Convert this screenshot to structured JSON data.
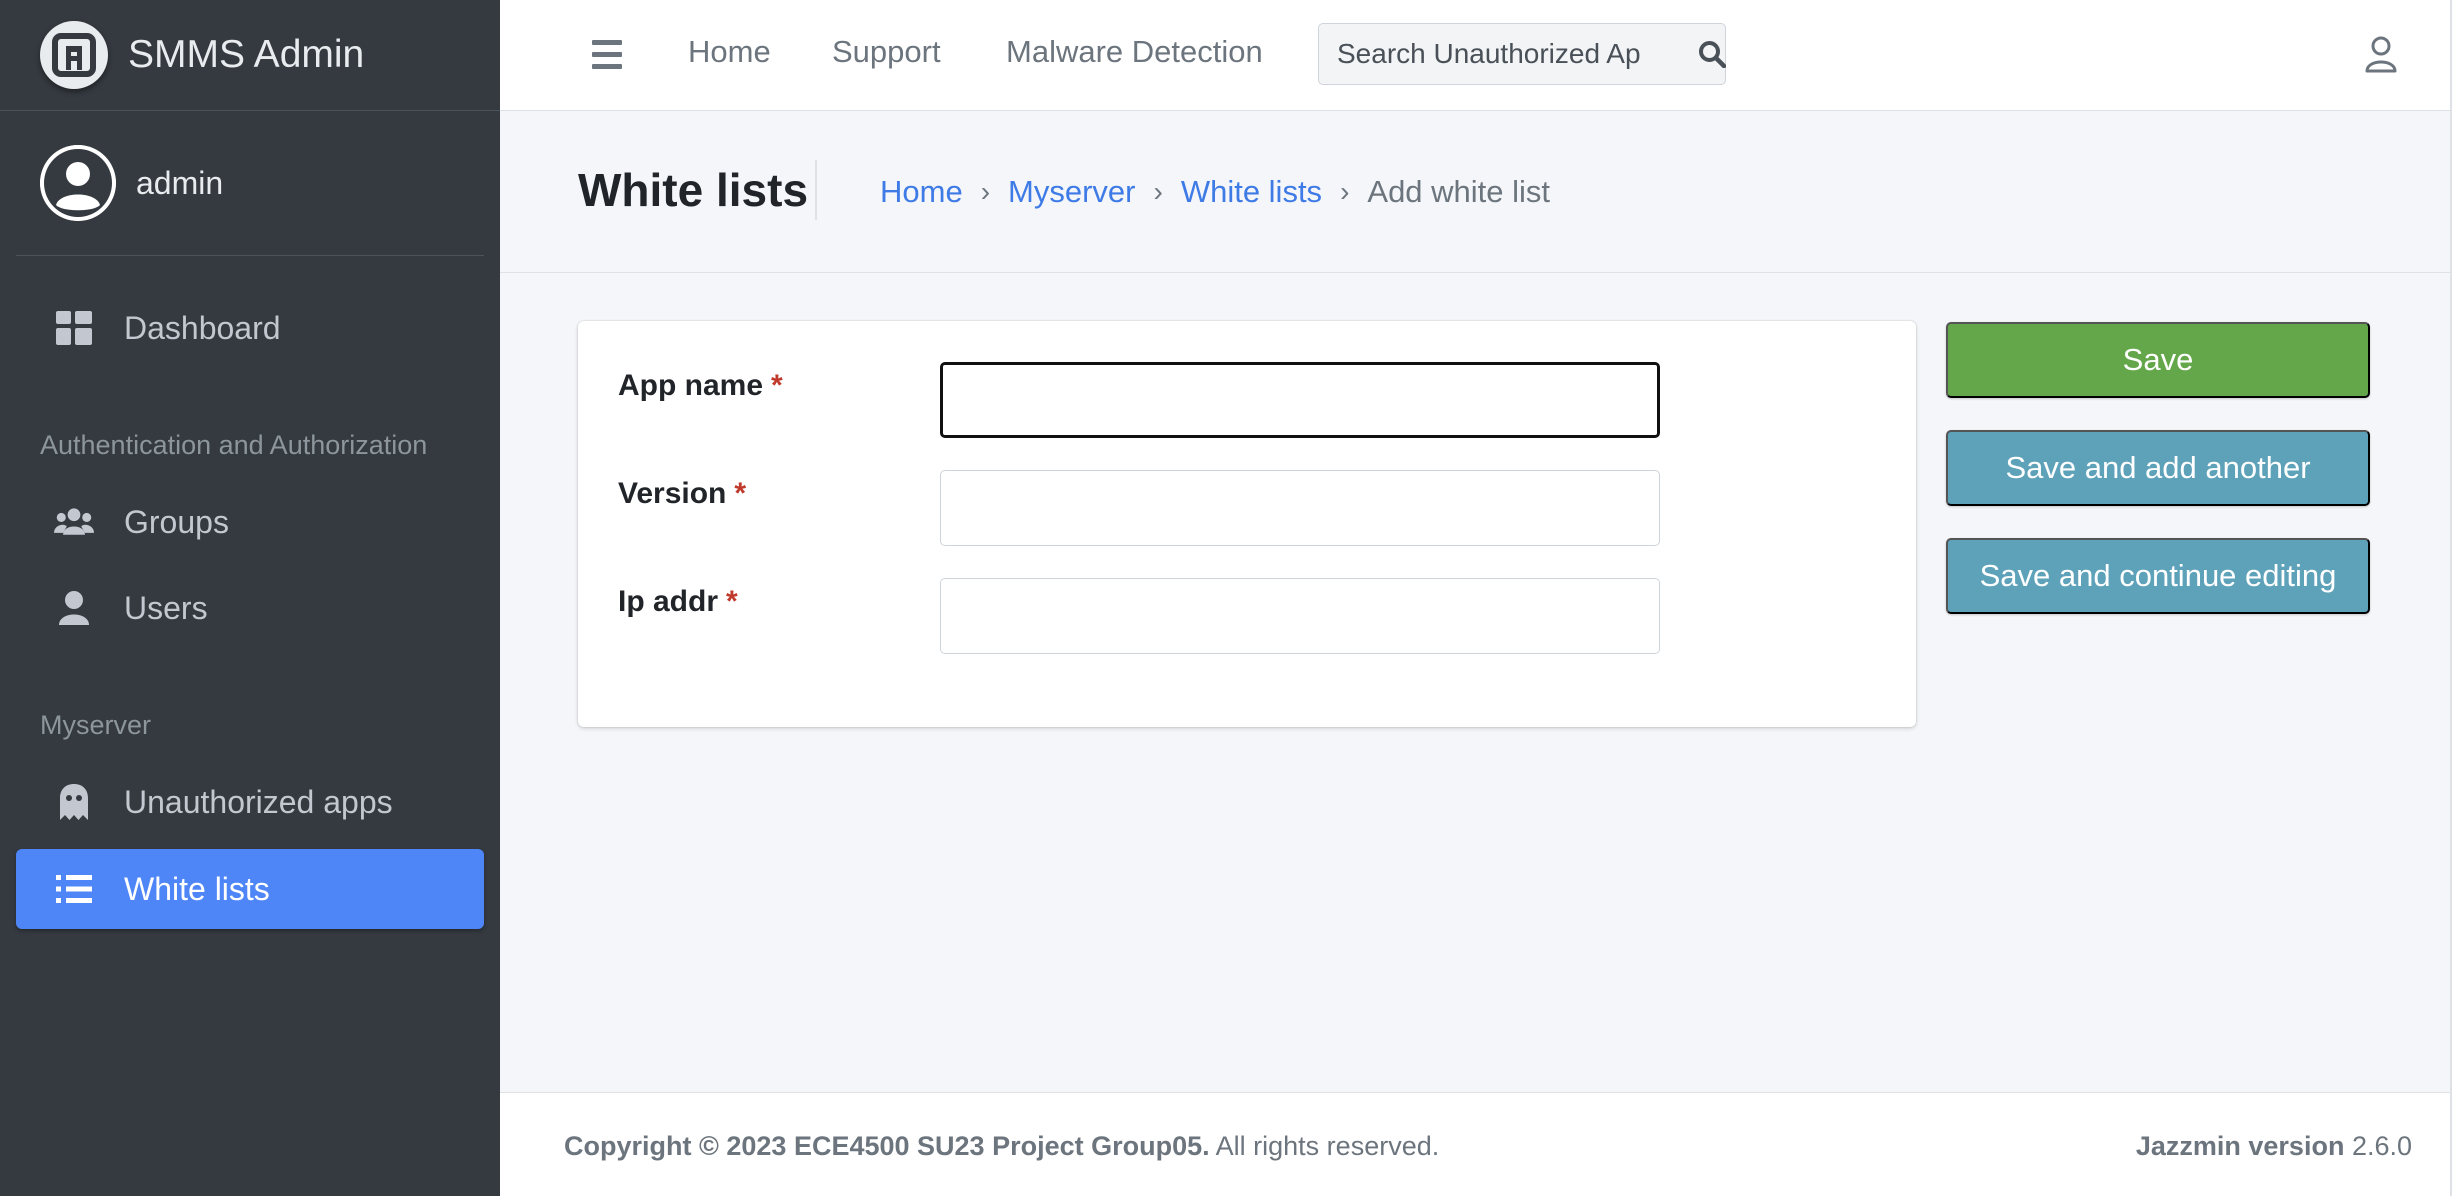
{
  "brand": {
    "name": "SMMS Admin",
    "logo_icon": "brand-logo-icon"
  },
  "user": {
    "name": "admin",
    "avatar_icon": "user-circle-icon"
  },
  "sidebar": {
    "items": [
      {
        "label": "Dashboard",
        "icon": "dashboard-icon"
      },
      {
        "label": "Groups",
        "icon": "users-group-icon"
      },
      {
        "label": "Users",
        "icon": "user-icon"
      },
      {
        "label": "Unauthorized apps",
        "icon": "ghost-icon"
      },
      {
        "label": "White lists",
        "icon": "list-icon",
        "active": true
      }
    ],
    "headers": [
      "Authentication and Authorization",
      "Myserver"
    ]
  },
  "topnav": {
    "links": [
      "Home",
      "Support",
      "Malware Detection"
    ],
    "search": {
      "placeholder": "Search Unauthorized Ap"
    }
  },
  "header": {
    "title": "White lists",
    "breadcrumb": [
      "Home",
      "Myserver",
      "White lists",
      "Add white list"
    ],
    "separator": "›"
  },
  "form": {
    "fields": [
      {
        "label": "App name",
        "required_mark": "*",
        "value": ""
      },
      {
        "label": "Version",
        "required_mark": "*",
        "value": ""
      },
      {
        "label": "Ip addr",
        "required_mark": "*",
        "value": ""
      }
    ]
  },
  "actions": {
    "save": "Save",
    "save_add_another": "Save and add another",
    "save_continue": "Save and continue editing"
  },
  "footer": {
    "copyright_bold": "Copyright © 2023 ECE4500 SU23 Project Group05.",
    "copyright_rest": " All rights reserved.",
    "version_label": "Jazzmin version",
    "version_value": " 2.6.0"
  },
  "colors": {
    "sidebar_bg": "#343a40",
    "active_item": "#4f86f7",
    "save_button": "#63a74a",
    "info_button": "#5ea2ba",
    "link": "#3e7be6"
  }
}
